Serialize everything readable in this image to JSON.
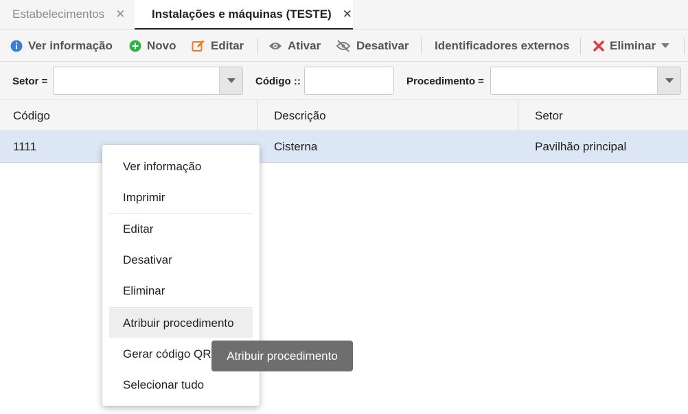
{
  "tabs": [
    {
      "label": "Estabelecimentos",
      "close": "✕",
      "active": false
    },
    {
      "label": "Instalações e máquinas (TESTE)",
      "close": "✕",
      "active": true
    }
  ],
  "toolbar": {
    "view_info": "Ver informação",
    "new": "Novo",
    "edit": "Editar",
    "activate": "Ativar",
    "deactivate": "Desativar",
    "external_ids": "Identificadores externos",
    "delete": "Eliminar",
    "icons": {
      "view_info": "info-icon",
      "new": "plus-circle-icon",
      "edit": "edit-icon",
      "activate": "eye-icon",
      "deactivate": "eye-off-icon",
      "delete": "x-icon",
      "delete_dropdown": "caret-down-icon"
    },
    "colors": {
      "info": "#3a7fd5",
      "new": "#2fb344",
      "edit": "#f07a22",
      "delete": "#e03b3b",
      "muted": "#7a7a7a"
    }
  },
  "filters": {
    "setor_label": "Setor =",
    "setor_value": "",
    "codigo_label": "Código ::",
    "codigo_value": "",
    "procedimento_label": "Procedimento =",
    "procedimento_value": ""
  },
  "grid": {
    "columns": [
      "Código",
      "Descrição",
      "Setor"
    ],
    "rows": [
      {
        "codigo": "1111",
        "descricao": "Cisterna",
        "setor": "Pavilhão principal"
      }
    ]
  },
  "context_menu": {
    "items": [
      "Ver informação",
      "Imprimir",
      "Editar",
      "Desativar",
      "Eliminar",
      "Atribuir procedimento",
      "Gerar código QR",
      "Selecionar tudo"
    ],
    "hovered": "Atribuir procedimento"
  },
  "tooltip": {
    "text": "Atribuir procedimento"
  }
}
